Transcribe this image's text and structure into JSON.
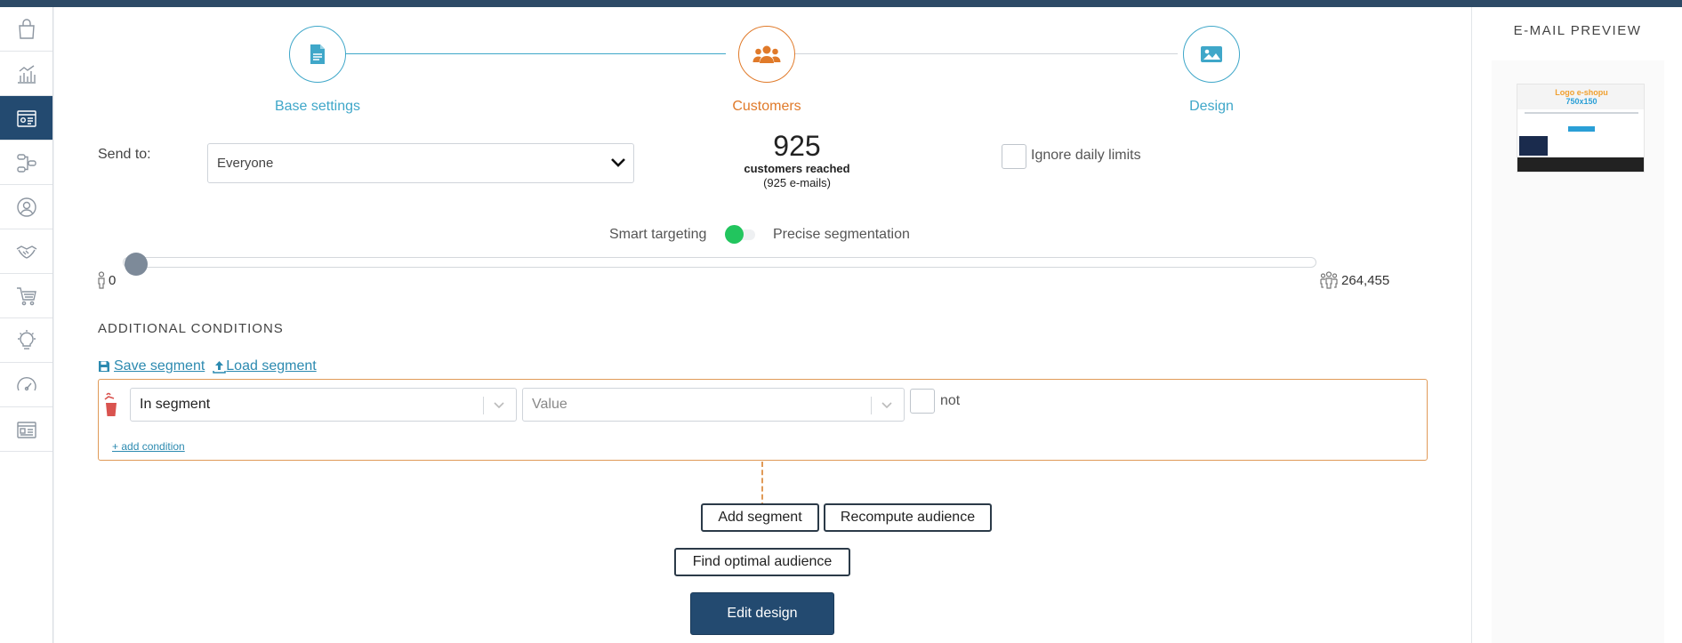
{
  "sidebar": {
    "items": [
      {
        "icon": "shopping-bag-icon"
      },
      {
        "icon": "bar-chart-icon"
      },
      {
        "icon": "contact-card-icon"
      },
      {
        "icon": "workflow-icon"
      },
      {
        "icon": "user-circle-icon"
      },
      {
        "icon": "handshake-icon"
      },
      {
        "icon": "cart-icon"
      },
      {
        "icon": "lightbulb-icon"
      },
      {
        "icon": "gauge-icon"
      },
      {
        "icon": "list-card-icon"
      }
    ]
  },
  "stepper": {
    "steps": [
      {
        "label": "Base settings",
        "icon": "document-icon"
      },
      {
        "label": "Customers",
        "icon": "users-icon"
      },
      {
        "label": "Design",
        "icon": "image-icon"
      }
    ]
  },
  "send_to": {
    "label": "Send to:",
    "value": "Everyone"
  },
  "reach": {
    "count": "925",
    "line1": "customers reached",
    "line2": "(925 e-mails)"
  },
  "ignore_limits": {
    "label": "Ignore daily limits"
  },
  "targeting": {
    "left": "Smart targeting",
    "right": "Precise segmentation",
    "toggle_on": true
  },
  "slider": {
    "min_label": "0",
    "max_label": "264,455",
    "value_fraction": 0.0
  },
  "conditions": {
    "title": "ADDITIONAL CONDITIONS",
    "save": "Save segment",
    "load": "Load segment",
    "segment_select": "In segment",
    "value_placeholder": "Value",
    "not_label": "not",
    "add_condition": "+ add condition"
  },
  "actions": {
    "add_segment": "Add segment",
    "recompute": "Recompute audience",
    "find_optimal": "Find optimal audience",
    "edit_design": "Edit design"
  },
  "preview": {
    "title": "E-MAIL PREVIEW",
    "logo_text": "Logo e-shopu",
    "logo_size": "750x150"
  },
  "colors": {
    "primary": "#234a70",
    "accent_blue": "#3fa7c9",
    "accent_orange": "#e07a2a",
    "condition_border": "#e09a58",
    "toggle_green": "#22c55e"
  }
}
